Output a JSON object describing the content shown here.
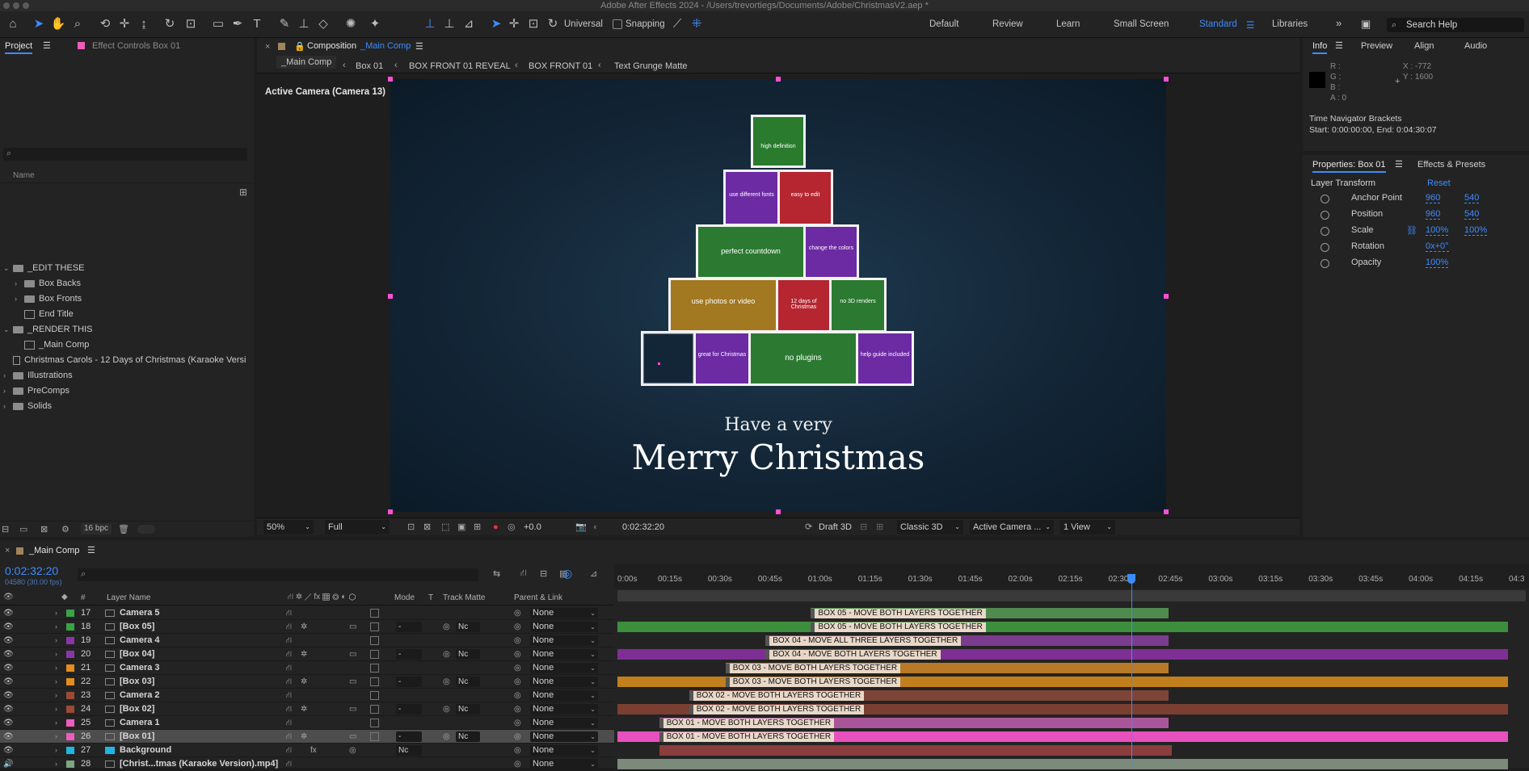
{
  "window_title": "Adobe After Effects 2024 - /Users/trevortiegs/Documents/Adobe/ChristmasV2.aep *",
  "toolbar": {
    "universal_label": "Universal",
    "snapping_label": "Snapping",
    "workspaces": [
      "Default",
      "Review",
      "Learn",
      "Small Screen",
      "Standard",
      "Libraries"
    ],
    "active_workspace": "Standard",
    "search_placeholder": "Search Help"
  },
  "project_panel": {
    "tab_project": "Project",
    "tab_effect_controls": "Effect Controls Box 01",
    "search_placeholder": "",
    "column_name": "Name",
    "items": [
      {
        "label": "_EDIT THESE",
        "type": "folder",
        "indent": 0,
        "expanded": true
      },
      {
        "label": "Box Backs",
        "type": "folder",
        "indent": 1,
        "expanded": false
      },
      {
        "label": "Box Fronts",
        "type": "folder",
        "indent": 1,
        "expanded": false
      },
      {
        "label": "End Title",
        "type": "comp",
        "indent": 1,
        "expanded": false
      },
      {
        "label": "_RENDER THIS",
        "type": "folder",
        "indent": 0,
        "expanded": true
      },
      {
        "label": "_Main Comp",
        "type": "comp",
        "indent": 1,
        "expanded": false
      },
      {
        "label": "Christmas Carols - 12 Days of Christmas (Karaoke Versi",
        "type": "footage",
        "indent": 0,
        "expanded": false
      },
      {
        "label": "Illustrations",
        "type": "folder",
        "indent": 0,
        "expanded": false
      },
      {
        "label": "PreComps",
        "type": "folder",
        "indent": 0,
        "expanded": false
      },
      {
        "label": "Solids",
        "type": "folder",
        "indent": 0,
        "expanded": false
      }
    ],
    "bpc_label": "16 bpc"
  },
  "composition_panel": {
    "tab_prefix": "Composition",
    "tab_name": "_Main Comp",
    "breadcrumbs": [
      "_Main Comp",
      "Box 01",
      "BOX FRONT 01 REVEAL",
      "BOX FRONT 01",
      "Text Grunge Matte"
    ],
    "camera_label": "Active Camera (Camera 13)",
    "greeting_small": "Have a very",
    "greeting_large": "Merry Christmas",
    "box_texts": {
      "r1": "high definition",
      "r2a": "use different fonts",
      "r2b": "easy to edit",
      "r3a": "perfect countdown",
      "r3b": "change the colors",
      "r4a": "use photos or video",
      "r4b": "12 days of Christmas",
      "r4c": "no 3D renders",
      "r5a": "great for Christmas",
      "r5b": "no plugins",
      "r5c": "help guide included"
    },
    "zoom": "50%",
    "resolution": "Full",
    "exposure": "+0.0",
    "timecode": "0:02:32:20",
    "draft3d": "Draft 3D",
    "renderer": "Classic 3D",
    "view_camera": "Active Camera ...",
    "views": "1 View"
  },
  "info_panel": {
    "tabs": [
      "Info",
      "Preview",
      "Align",
      "Audio"
    ],
    "r": "R :",
    "g": "G :",
    "b": "B :",
    "a": "A :  0",
    "x": "X : -772",
    "y": "Y : 1600",
    "nav_title": "Time Navigator Brackets",
    "nav_range": "Start: 0:00:00:00, End: 0:04:30:07"
  },
  "properties_panel": {
    "tab_properties": "Properties: Box 01",
    "tab_effects": "Effects & Presets",
    "section": "Layer Transform",
    "reset": "Reset",
    "rows": [
      {
        "label": "Anchor Point",
        "v1": "960",
        "v2": "540",
        "link": false
      },
      {
        "label": "Position",
        "v1": "960",
        "v2": "540",
        "link": false
      },
      {
        "label": "Scale",
        "v1": "100%",
        "v2": "100%",
        "link": true
      },
      {
        "label": "Rotation",
        "v1": "0x+0°",
        "v2": "",
        "link": false
      },
      {
        "label": "Opacity",
        "v1": "100%",
        "v2": "",
        "link": false
      }
    ]
  },
  "timeline": {
    "tab": "_Main Comp",
    "timecode": "0:02:32:20",
    "frames": "04580 (30.00 fps)",
    "col_layer_name": "Layer Name",
    "col_mode": "Mode",
    "col_t": "T",
    "col_track_matte": "Track Matte",
    "col_parent": "Parent & Link",
    "ruler": [
      "0:00s",
      "00:15s",
      "00:30s",
      "00:45s",
      "01:00s",
      "01:15s",
      "01:30s",
      "01:45s",
      "02:00s",
      "02:15s",
      "02:30s",
      "02:45s",
      "03:00s",
      "03:15s",
      "03:30s",
      "03:45s",
      "04:00s",
      "04:15s",
      "04:3"
    ],
    "playhead_fraction": 0.5655,
    "layers": [
      {
        "num": "17",
        "name": "Camera 5",
        "color": "#3aa346",
        "kind": "camera",
        "parent": "None"
      },
      {
        "num": "18",
        "name": "[Box 05]",
        "color": "#3aa346",
        "kind": "precomp",
        "parent": "None",
        "mode": "-",
        "tm": "Nc"
      },
      {
        "num": "19",
        "name": "Camera 4",
        "color": "#8a35a6",
        "kind": "camera",
        "parent": "None"
      },
      {
        "num": "20",
        "name": "[Box 04]",
        "color": "#8a35a6",
        "kind": "precomp",
        "parent": "None",
        "mode": "-",
        "tm": "Nc"
      },
      {
        "num": "21",
        "name": "Camera 3",
        "color": "#e28e1f",
        "kind": "camera",
        "parent": "None"
      },
      {
        "num": "22",
        "name": "[Box 03]",
        "color": "#e28e1f",
        "kind": "precomp",
        "parent": "None",
        "mode": "-",
        "tm": "Nc"
      },
      {
        "num": "23",
        "name": "Camera 2",
        "color": "#9a4a36",
        "kind": "camera",
        "parent": "None"
      },
      {
        "num": "24",
        "name": "[Box 02]",
        "color": "#9a4a36",
        "kind": "precomp",
        "parent": "None",
        "mode": "-",
        "tm": "Nc"
      },
      {
        "num": "25",
        "name": "Camera 1",
        "color": "#ee5cbd",
        "kind": "camera",
        "parent": "None"
      },
      {
        "num": "26",
        "name": "[Box 01]",
        "color": "#ee5cbd",
        "kind": "precomp",
        "parent": "None",
        "mode": "-",
        "tm": "Nc",
        "selected": true
      },
      {
        "num": "27",
        "name": "Background",
        "color": "#1fb6e3",
        "kind": "solid",
        "parent": "None",
        "mode": "Nc",
        "tm": ""
      },
      {
        "num": "28",
        "name": "[Christ...tmas (Karaoke Version).mp4]",
        "color": "#7fa582",
        "kind": "audio",
        "parent": "None"
      }
    ],
    "tracks": [
      {
        "start": 0.213,
        "end": 0.607,
        "color": "#4f8a4f",
        "marker": "BOX 05 - MOVE BOTH LAYERS TOGETHER",
        "mstart": 0.213
      },
      {
        "start": 0.0,
        "end": 0.98,
        "color": "#3d8f3d",
        "marker": "BOX 05 - MOVE BOTH LAYERS TOGETHER",
        "mstart": 0.213
      },
      {
        "start": 0.163,
        "end": 0.607,
        "color": "#7a3d8e",
        "marker": "BOX 04 - MOVE ALL THREE LAYERS TOGETHER",
        "mstart": 0.163
      },
      {
        "start": 0.0,
        "end": 0.98,
        "color": "#7e2f94",
        "marker": "BOX 04 - MOVE BOTH LAYERS TOGETHER",
        "mstart": 0.163
      },
      {
        "start": 0.119,
        "end": 0.607,
        "color": "#b87a26",
        "marker": "BOX 03 - MOVE BOTH LAYERS TOGETHER",
        "mstart": 0.119
      },
      {
        "start": 0.0,
        "end": 0.98,
        "color": "#c27f1d",
        "marker": "BOX 03 - MOVE BOTH LAYERS TOGETHER",
        "mstart": 0.119
      },
      {
        "start": 0.079,
        "end": 0.607,
        "color": "#7d4538",
        "marker": "BOX 02 - MOVE BOTH LAYERS TOGETHER",
        "mstart": 0.079
      },
      {
        "start": 0.0,
        "end": 0.98,
        "color": "#7a3f31",
        "marker": "BOX 02 - MOVE BOTH LAYERS TOGETHER",
        "mstart": 0.079
      },
      {
        "start": 0.046,
        "end": 0.607,
        "color": "#a9559a",
        "marker": "BOX 01 - MOVE BOTH LAYERS TOGETHER",
        "mstart": 0.046
      },
      {
        "start": 0.0,
        "end": 0.98,
        "color": "#e651bd",
        "marker": "BOX 01 - MOVE BOTH LAYERS TOGETHER",
        "mstart": 0.046
      },
      {
        "start": 0.046,
        "end": 0.61,
        "color": "#8a3d3d",
        "marker": "",
        "mstart": 0
      },
      {
        "start": 0.0,
        "end": 0.98,
        "color": "#7b8a7b",
        "marker": "",
        "mstart": 0
      }
    ]
  }
}
